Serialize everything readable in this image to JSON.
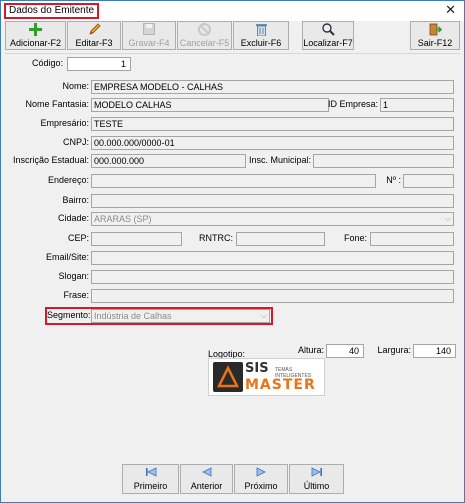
{
  "window": {
    "title": "Dados do Emitente",
    "close": "✕"
  },
  "toolbar": {
    "add": {
      "label": "Adicionar-F2",
      "icon": "add-icon"
    },
    "edit": {
      "label": "Editar-F3",
      "icon": "pencil-icon"
    },
    "save": {
      "label": "Gravar-F4",
      "icon": "save-icon"
    },
    "cancel": {
      "label": "Cancelar-F5",
      "icon": "cancel-icon"
    },
    "delete": {
      "label": "Excluir-F6",
      "icon": "trash-icon"
    },
    "search": {
      "label": "Localizar-F7",
      "icon": "search-icon"
    },
    "exit": {
      "label": "Sair-F12",
      "icon": "exit-icon"
    }
  },
  "form": {
    "codigo": {
      "label": "Código:",
      "value": "1"
    },
    "nome": {
      "label": "Nome:",
      "value": "EMPRESA MODELO - CALHAS"
    },
    "nome_fantasia": {
      "label": "Nome Fantasia:",
      "value": "MODELO CALHAS"
    },
    "id_empresa": {
      "label": "ID Empresa:",
      "value": "1"
    },
    "empresario": {
      "label": "Empresário:",
      "value": "TESTE"
    },
    "cnpj": {
      "label": "CNPJ:",
      "value": "00.000.000/0000-01"
    },
    "inscricao_estadual": {
      "label": "Inscrição Estadual:",
      "value": "000.000.000"
    },
    "inscricao_municipal": {
      "label": "Insc. Municipal:",
      "value": ""
    },
    "endereco": {
      "label": "Endereço:",
      "value": ""
    },
    "numero": {
      "label": "Nº :",
      "value": ""
    },
    "bairro": {
      "label": "Bairro:",
      "value": ""
    },
    "cidade": {
      "label": "Cidade:",
      "value": "ARARAS (SP)"
    },
    "cep": {
      "label": "CEP:",
      "value": ""
    },
    "rntrc": {
      "label": "RNTRC:",
      "value": ""
    },
    "fone": {
      "label": "Fone:",
      "value": ""
    },
    "email_site": {
      "label": "Email/Site:",
      "value": ""
    },
    "slogan": {
      "label": "Slogan:",
      "value": ""
    },
    "frase": {
      "label": "Frase:",
      "value": ""
    },
    "segmento": {
      "label": "Segmento:",
      "value": "Indústria de Calhas"
    }
  },
  "logo": {
    "label": "Logotipo:",
    "altura_label": "Altura:",
    "altura_value": "40",
    "largura_label": "Largura:",
    "largura_value": "140",
    "brand_big": "SIS",
    "brand_small": "TEMAS INTELIGENTES",
    "brand_bottom": "MASTER"
  },
  "navigation": {
    "first": {
      "label": "Primeiro",
      "icon": "first-icon"
    },
    "prev": {
      "label": "Anterior",
      "icon": "prev-icon"
    },
    "next": {
      "label": "Próximo",
      "icon": "next-icon"
    },
    "last": {
      "label": "Último",
      "icon": "last-icon"
    }
  },
  "colors": {
    "highlight": "#d6182a",
    "accent": "#3a6fc0",
    "logo_orange": "#e8751a"
  }
}
